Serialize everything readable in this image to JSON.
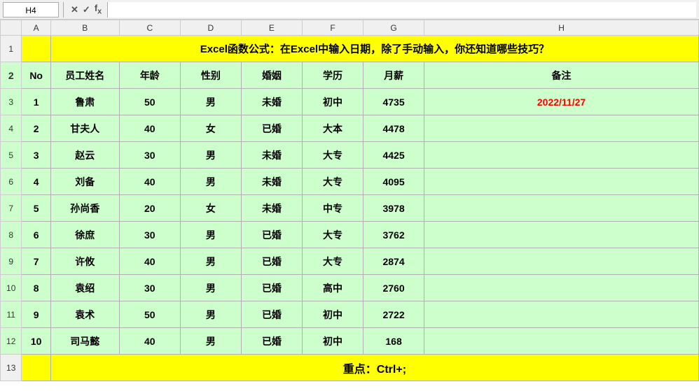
{
  "formula_bar": {
    "cell_ref": "H4",
    "formula_content": ""
  },
  "title_row": {
    "text": "Excel函数公式：在Excel中输入日期，除了手动输入，你还知道哪些技巧？"
  },
  "footer_row": {
    "text": "重点：Ctrl+;"
  },
  "col_headers": [
    "A",
    "B",
    "C",
    "D",
    "E",
    "F",
    "G",
    "H"
  ],
  "header_labels": {
    "no": "No",
    "name": "员工姓名",
    "age": "年龄",
    "gender": "性别",
    "marriage": "婚姻",
    "education": "学历",
    "salary": "月薪",
    "notes": "备注"
  },
  "employees": [
    {
      "no": "1",
      "name": "鲁肃",
      "age": "50",
      "gender": "男",
      "marriage": "未婚",
      "education": "初中",
      "salary": "4735",
      "notes": "2022/11/27",
      "notes_red": true
    },
    {
      "no": "2",
      "name": "甘夫人",
      "age": "40",
      "gender": "女",
      "marriage": "已婚",
      "education": "大本",
      "salary": "4478",
      "notes": ""
    },
    {
      "no": "3",
      "name": "赵云",
      "age": "30",
      "gender": "男",
      "marriage": "未婚",
      "education": "大专",
      "salary": "4425",
      "notes": ""
    },
    {
      "no": "4",
      "name": "刘备",
      "age": "40",
      "gender": "男",
      "marriage": "未婚",
      "education": "大专",
      "salary": "4095",
      "notes": ""
    },
    {
      "no": "5",
      "name": "孙尚香",
      "age": "20",
      "gender": "女",
      "marriage": "未婚",
      "education": "中专",
      "salary": "3978",
      "notes": ""
    },
    {
      "no": "6",
      "name": "徐庶",
      "age": "30",
      "gender": "男",
      "marriage": "已婚",
      "education": "大专",
      "salary": "3762",
      "notes": ""
    },
    {
      "no": "7",
      "name": "许攸",
      "age": "40",
      "gender": "男",
      "marriage": "已婚",
      "education": "大专",
      "salary": "2874",
      "notes": ""
    },
    {
      "no": "8",
      "name": "袁绍",
      "age": "30",
      "gender": "男",
      "marriage": "已婚",
      "education": "高中",
      "salary": "2760",
      "notes": ""
    },
    {
      "no": "9",
      "name": "袁术",
      "age": "50",
      "gender": "男",
      "marriage": "已婚",
      "education": "初中",
      "salary": "2722",
      "notes": ""
    },
    {
      "no": "10",
      "name": "司马懿",
      "age": "40",
      "gender": "男",
      "marriage": "已婚",
      "education": "初中",
      "salary": "168",
      "notes": ""
    }
  ],
  "row_numbers": [
    "1",
    "2",
    "3",
    "4",
    "5",
    "6",
    "7",
    "8",
    "9",
    "10",
    "11",
    "12",
    "13"
  ]
}
